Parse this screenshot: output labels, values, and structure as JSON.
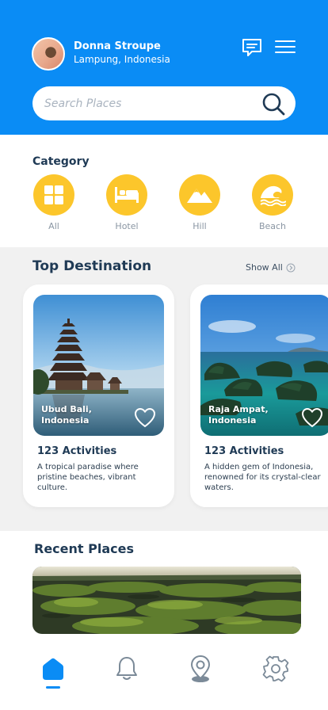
{
  "header": {
    "user_name": "Donna Stroupe",
    "user_location": "Lampung, Indonesia",
    "search_placeholder": "Search Places"
  },
  "category": {
    "title": "Category",
    "items": [
      {
        "label": "All",
        "icon": "grid-icon"
      },
      {
        "label": "Hotel",
        "icon": "bed-icon"
      },
      {
        "label": "Hill",
        "icon": "mountain-icon"
      },
      {
        "label": "Beach",
        "icon": "wave-icon"
      }
    ]
  },
  "destinations": {
    "title": "Top Destination",
    "show_all": "Show All",
    "cards": [
      {
        "place": "Ubud Bali, Indonesia",
        "activities": "123 Activities",
        "description": "A tropical paradise where pristine beaches, vibrant culture."
      },
      {
        "place": "Raja Ampat, Indonesia",
        "activities": "123 Activities",
        "description": "A hidden gem of Indonesia, renowned for its crystal-clear waters."
      }
    ]
  },
  "recent": {
    "title": "Recent Places"
  },
  "colors": {
    "primary": "#0a8cf5",
    "accent": "#fcc62b",
    "text_dark": "#1f3a55",
    "nav_inactive": "#7b8a98"
  },
  "nav": [
    "home-icon",
    "bell-icon",
    "location-pin-icon",
    "gear-icon"
  ]
}
